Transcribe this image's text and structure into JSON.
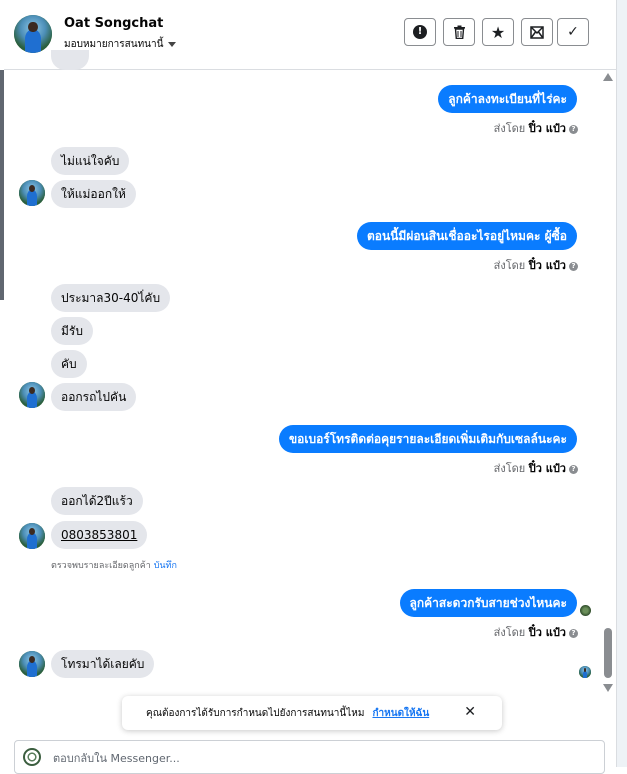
{
  "header": {
    "name": "Oat Songchat",
    "assign_label": "มอบหมายการสนทนานี้",
    "tools": [
      {
        "name": "report-spam-icon",
        "glyph": "!"
      },
      {
        "name": "trash-icon",
        "glyph": "🗑"
      },
      {
        "name": "star-icon",
        "glyph": "★"
      },
      {
        "name": "mark-unread-icon",
        "glyph": "✉"
      },
      {
        "name": "done-check-icon",
        "glyph": "✓"
      }
    ]
  },
  "messages": {
    "out1": "ลูกค้าลงทะเบียนที่ไร่คะ",
    "in1": "ไม่แน่ใจคับ",
    "in2": "ให้แม่ออกให้",
    "out2": "ตอนนี้มีผ่อนสินเชื่ออะไรอยู่ไหมคะ ผู้ซื้อ",
    "in3": "ประมาล30-40ไ่คับ",
    "in4": "มีรับ",
    "in5": "คับ",
    "in6": "ออกรถไปคัน",
    "out3": "ขอเบอร์โทรติดต่อคุยรายละเอียดเพิ่มเติมกับเซลล์นะคะ",
    "in7": "ออกได้2ปีแร้ว",
    "in8": "0803853801",
    "out4": "ลูกค้าสะดวกรับสายช่วงไหนคะ",
    "in9": "โทรมาได้เลยคับ"
  },
  "sent_by": {
    "prefix": "ส่งโดย",
    "sender": "ปิ๋ว แป๋ว",
    "info": "?"
  },
  "detect_note": {
    "text": "ตรวจพบรายละเอียดลูกค้า",
    "link": "บันทึก"
  },
  "toast": {
    "text": "คุณต้องการได้รับการกำหนดไปยังการสนทนานี้ไหม",
    "action": "กำหนดให้ฉัน",
    "close": "✕"
  },
  "composer": {
    "placeholder": "ตอบกลับใน Messenger..."
  },
  "colors": {
    "outgoing": "#0a7cff",
    "incoming": "#e4e6eb",
    "link": "#1877f2"
  }
}
